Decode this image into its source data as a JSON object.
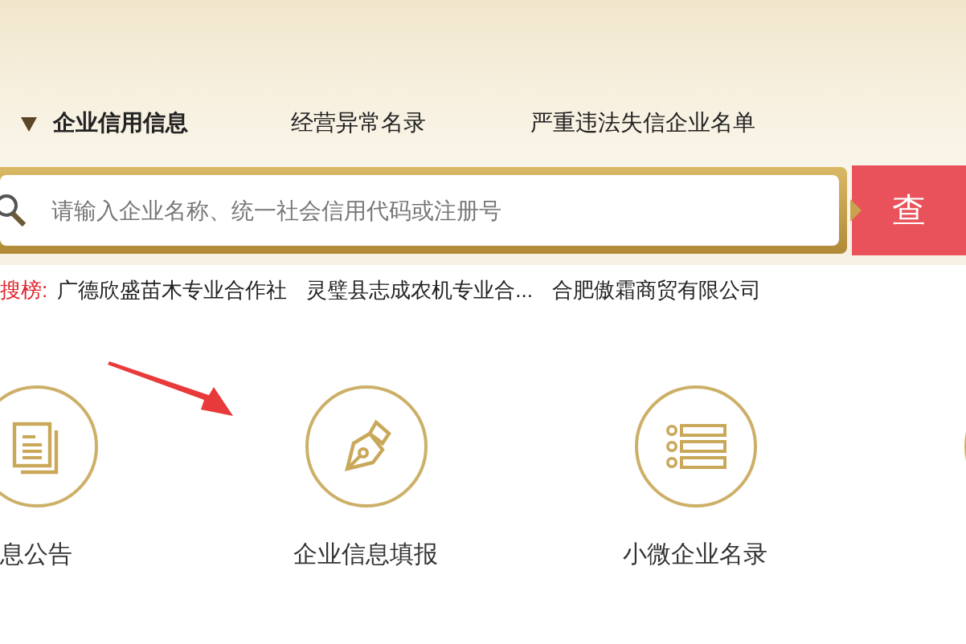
{
  "tabs": [
    {
      "label": "企业信用信息",
      "selected": true
    },
    {
      "label": "经营异常名录",
      "selected": false
    },
    {
      "label": "严重违法失信企业名单",
      "selected": false
    }
  ],
  "search": {
    "placeholder": "请输入企业名称、统一社会信用代码或注册号",
    "button": "查"
  },
  "hot_searches": {
    "label": "搜榜:",
    "items": [
      "广德欣盛苗木专业合作社",
      "灵璧县志成农机专业合...",
      "合肥傲霜商贸有限公司"
    ]
  },
  "services": [
    {
      "kind": "document",
      "label": "息公告"
    },
    {
      "kind": "pen",
      "label": "企业信息填报"
    },
    {
      "kind": "list",
      "label": "小微企业名录"
    },
    {
      "kind": "partial"
    }
  ]
}
